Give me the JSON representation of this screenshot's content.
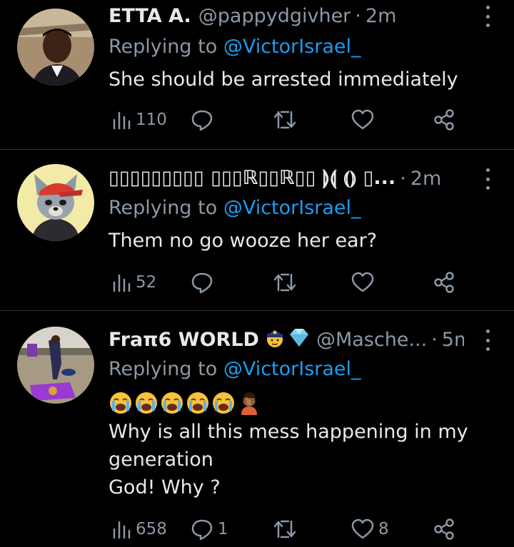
{
  "tweets": [
    {
      "name": "ETTA A.",
      "handle": "@pappydgivher",
      "time": "2m",
      "replying_label": "Replying to",
      "mention": "@VictorIsrael_",
      "text_lines": [
        "She should be arrested immediately"
      ],
      "views": "110",
      "replies": "",
      "retweets": "",
      "likes": ""
    },
    {
      "name": "▯▯▯▯▯▯▯▯▯ ▯▯▯ℝ▯▯ℝ▯▯ ⟭⟬ ⦅⦆ ▯...",
      "handle": "",
      "time": "2m",
      "replying_label": "Replying to",
      "mention": "@VictorIsrael_",
      "text_lines": [
        "Them no go wooze her ear?"
      ],
      "views": "52",
      "replies": "",
      "retweets": "",
      "likes": ""
    },
    {
      "name": "Fraπ6 WORLD",
      "handle": "@Masche...",
      "time": "5m",
      "replying_label": "Replying to",
      "mention": "@VictorIsrael_",
      "emoji_names": [
        "loudly-crying-face-icon",
        "loudly-crying-face-icon",
        "loudly-crying-face-icon",
        "loudly-crying-face-icon",
        "loudly-crying-face-icon",
        "woman-facepalming-icon"
      ],
      "text_lines": [
        "Why is all this mess happening in my",
        "generation",
        "God! Why ?"
      ],
      "views": "658",
      "replies": "1",
      "retweets": "",
      "likes": "8"
    }
  ],
  "colors": {
    "background": "#000000",
    "text": "#e7e9ea",
    "muted": "#8b98a5",
    "link": "#1d9bf0",
    "divider": "#2f3336"
  }
}
